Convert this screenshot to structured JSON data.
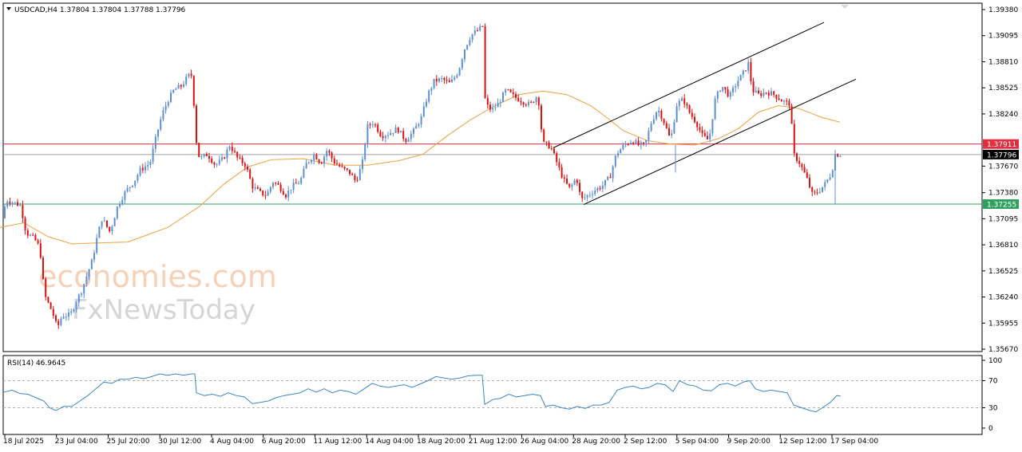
{
  "header": {
    "symbol_label": "USDCAD,H4  1.37804 1.37804 1.37788 1.37796"
  },
  "rsi_header": {
    "label": "RSI(14) 46.9645"
  },
  "watermark": {
    "line1": "economies.com",
    "line2": "FxNewsToday"
  },
  "colors": {
    "bull": "#5b8fd6",
    "bear": "#e01010",
    "ma": "#f0a040",
    "resistance": "#e03040",
    "support": "#30a060",
    "price_line": "#a0a0a0",
    "rsi": "#3a86c8",
    "channel": "#000000"
  },
  "chart_data": [
    {
      "type": "candlestick",
      "timeframe": "H4",
      "ylim": [
        1.3567,
        1.3938
      ],
      "y_ticks": [
        1.3938,
        1.39095,
        1.3881,
        1.38525,
        1.3824,
        1.3767,
        1.3738,
        1.37095,
        1.3681,
        1.36525,
        1.3624,
        1.35955,
        1.3567
      ],
      "x_tick_labels": [
        "18 Jul 2025",
        "23 Jul 04:00",
        "25 Jul 20:00",
        "30 Jul 12:00",
        "4 Aug 04:00",
        "6 Aug 20:00",
        "11 Aug 12:00",
        "14 Aug 04:00",
        "18 Aug 20:00",
        "21 Aug 12:00",
        "26 Aug 04:00",
        "28 Aug 20:00",
        "2 Sep 12:00",
        "5 Sep 04:00",
        "9 Sep 20:00",
        "12 Sep 12:00",
        "17 Sep 04:00"
      ],
      "current_price": {
        "value": 1.37796,
        "label": "1.37796"
      },
      "resistance_level": {
        "value": 1.37911,
        "label": "1.37911"
      },
      "support_level": {
        "value": 1.37255,
        "label": "1.37255"
      },
      "moving_average_path": [
        [
          0,
          1.37
        ],
        [
          30,
          1.3705
        ],
        [
          60,
          1.369
        ],
        [
          90,
          1.3682
        ],
        [
          120,
          1.3683
        ],
        [
          160,
          1.3684
        ],
        [
          210,
          1.37
        ],
        [
          250,
          1.3723
        ],
        [
          280,
          1.3747
        ],
        [
          310,
          1.3766
        ],
        [
          340,
          1.3774
        ],
        [
          380,
          1.3775
        ],
        [
          420,
          1.3768
        ],
        [
          460,
          1.3768
        ],
        [
          500,
          1.3773
        ],
        [
          530,
          1.378
        ],
        [
          560,
          1.38
        ],
        [
          590,
          1.3818
        ],
        [
          620,
          1.3833
        ],
        [
          650,
          1.3845
        ],
        [
          680,
          1.3849
        ],
        [
          710,
          1.3845
        ],
        [
          740,
          1.3833
        ],
        [
          760,
          1.382
        ],
        [
          780,
          1.3806
        ],
        [
          810,
          1.3795
        ],
        [
          840,
          1.3791
        ],
        [
          870,
          1.379
        ],
        [
          900,
          1.3797
        ],
        [
          925,
          1.3808
        ],
        [
          950,
          1.3826
        ],
        [
          975,
          1.3833
        ],
        [
          1000,
          1.383
        ],
        [
          1030,
          1.382
        ],
        [
          1052,
          1.3815
        ]
      ],
      "channel_lines": [
        {
          "from": [
            693,
            1.3787
          ],
          "to": [
            1032,
            1.3924
          ]
        },
        {
          "from": [
            731,
            1.3725
          ],
          "to": [
            1072,
            1.3862
          ]
        }
      ],
      "price_path": [
        [
          5,
          1.371
        ],
        [
          10,
          1.373
        ],
        [
          20,
          1.3727
        ],
        [
          28,
          1.3724
        ],
        [
          35,
          1.3694
        ],
        [
          45,
          1.3688
        ],
        [
          52,
          1.3678
        ],
        [
          58,
          1.3626
        ],
        [
          68,
          1.3607
        ],
        [
          74,
          1.359
        ],
        [
          80,
          1.3604
        ],
        [
          90,
          1.3604
        ],
        [
          98,
          1.362
        ],
        [
          104,
          1.363
        ],
        [
          110,
          1.3645
        ],
        [
          118,
          1.3665
        ],
        [
          124,
          1.369
        ],
        [
          130,
          1.371
        ],
        [
          140,
          1.3695
        ],
        [
          150,
          1.3725
        ],
        [
          160,
          1.374
        ],
        [
          170,
          1.375
        ],
        [
          178,
          1.3763
        ],
        [
          190,
          1.377
        ],
        [
          198,
          1.38
        ],
        [
          205,
          1.3823
        ],
        [
          212,
          1.3838
        ],
        [
          220,
          1.385
        ],
        [
          230,
          1.3855
        ],
        [
          238,
          1.3866
        ],
        [
          244,
          1.3866
        ],
        [
          246,
          1.3805
        ],
        [
          252,
          1.3775
        ],
        [
          262,
          1.378
        ],
        [
          272,
          1.3768
        ],
        [
          282,
          1.3775
        ],
        [
          290,
          1.379
        ],
        [
          300,
          1.3775
        ],
        [
          310,
          1.3768
        ],
        [
          318,
          1.3745
        ],
        [
          328,
          1.3738
        ],
        [
          336,
          1.3735
        ],
        [
          344,
          1.375
        ],
        [
          352,
          1.3745
        ],
        [
          360,
          1.3735
        ],
        [
          368,
          1.3745
        ],
        [
          378,
          1.375
        ],
        [
          386,
          1.377
        ],
        [
          396,
          1.378
        ],
        [
          404,
          1.377
        ],
        [
          412,
          1.3785
        ],
        [
          420,
          1.3772
        ],
        [
          430,
          1.3765
        ],
        [
          440,
          1.376
        ],
        [
          448,
          1.375
        ],
        [
          456,
          1.377
        ],
        [
          462,
          1.381
        ],
        [
          470,
          1.3815
        ],
        [
          480,
          1.38
        ],
        [
          490,
          1.3803
        ],
        [
          500,
          1.3808
        ],
        [
          510,
          1.3795
        ],
        [
          520,
          1.3805
        ],
        [
          530,
          1.382
        ],
        [
          538,
          1.3845
        ],
        [
          546,
          1.386
        ],
        [
          556,
          1.3862
        ],
        [
          566,
          1.3857
        ],
        [
          576,
          1.387
        ],
        [
          584,
          1.3895
        ],
        [
          592,
          1.391
        ],
        [
          600,
          1.3915
        ],
        [
          607,
          1.392
        ],
        [
          610,
          1.3835
        ],
        [
          618,
          1.3828
        ],
        [
          626,
          1.3835
        ],
        [
          636,
          1.385
        ],
        [
          646,
          1.3843
        ],
        [
          656,
          1.3838
        ],
        [
          666,
          1.3834
        ],
        [
          676,
          1.3845
        ],
        [
          682,
          1.3792
        ],
        [
          692,
          1.3788
        ],
        [
          700,
          1.377
        ],
        [
          708,
          1.3752
        ],
        [
          716,
          1.3742
        ],
        [
          724,
          1.3755
        ],
        [
          730,
          1.373
        ],
        [
          738,
          1.3735
        ],
        [
          746,
          1.374
        ],
        [
          756,
          1.3745
        ],
        [
          766,
          1.3755
        ],
        [
          774,
          1.378
        ],
        [
          784,
          1.379
        ],
        [
          794,
          1.3795
        ],
        [
          802,
          1.379
        ],
        [
          810,
          1.379
        ],
        [
          818,
          1.3815
        ],
        [
          826,
          1.383
        ],
        [
          834,
          1.3815
        ],
        [
          842,
          1.3795
        ],
        [
          850,
          1.3835
        ],
        [
          858,
          1.384
        ],
        [
          866,
          1.3825
        ],
        [
          874,
          1.3815
        ],
        [
          882,
          1.38
        ],
        [
          890,
          1.3795
        ],
        [
          898,
          1.384
        ],
        [
          906,
          1.3855
        ],
        [
          916,
          1.3843
        ],
        [
          926,
          1.386
        ],
        [
          934,
          1.387
        ],
        [
          940,
          1.388
        ],
        [
          944,
          1.385
        ],
        [
          952,
          1.3845
        ],
        [
          962,
          1.3848
        ],
        [
          972,
          1.3845
        ],
        [
          982,
          1.3838
        ],
        [
          992,
          1.3835
        ],
        [
          996,
          1.378
        ],
        [
          1004,
          1.377
        ],
        [
          1012,
          1.3755
        ],
        [
          1020,
          1.3735
        ],
        [
          1028,
          1.374
        ],
        [
          1036,
          1.3748
        ],
        [
          1044,
          1.376
        ],
        [
          1048,
          1.378
        ],
        [
          1053,
          1.37796
        ]
      ]
    },
    {
      "type": "line",
      "title": "RSI(14) 46.9645",
      "ylim": [
        0,
        100
      ],
      "y_ticks": [
        100,
        70,
        30,
        0
      ],
      "levels": [
        70,
        30
      ],
      "series": [
        {
          "values": [
            [
              5,
              53
            ],
            [
              15,
              56
            ],
            [
              25,
              51
            ],
            [
              35,
              50
            ],
            [
              45,
              45
            ],
            [
              55,
              40
            ],
            [
              62,
              30
            ],
            [
              70,
              26
            ],
            [
              80,
              32
            ],
            [
              90,
              32
            ],
            [
              100,
              40
            ],
            [
              110,
              48
            ],
            [
              120,
              58
            ],
            [
              130,
              68
            ],
            [
              140,
              66
            ],
            [
              150,
              72
            ],
            [
              160,
              72
            ],
            [
              170,
              75
            ],
            [
              180,
              73
            ],
            [
              190,
              76
            ],
            [
              200,
              80
            ],
            [
              210,
              78
            ],
            [
              220,
              80
            ],
            [
              230,
              78
            ],
            [
              240,
              80
            ],
            [
              244,
              80
            ],
            [
              246,
              52
            ],
            [
              256,
              48
            ],
            [
              266,
              50
            ],
            [
              276,
              47
            ],
            [
              286,
              52
            ],
            [
              296,
              48
            ],
            [
              306,
              46
            ],
            [
              316,
              36
            ],
            [
              326,
              38
            ],
            [
              336,
              40
            ],
            [
              346,
              45
            ],
            [
              356,
              48
            ],
            [
              366,
              50
            ],
            [
              376,
              52
            ],
            [
              386,
              58
            ],
            [
              396,
              53
            ],
            [
              406,
              58
            ],
            [
              416,
              52
            ],
            [
              426,
              56
            ],
            [
              436,
              54
            ],
            [
              446,
              50
            ],
            [
              456,
              58
            ],
            [
              466,
              66
            ],
            [
              476,
              62
            ],
            [
              486,
              60
            ],
            [
              496,
              62
            ],
            [
              506,
              64
            ],
            [
              516,
              60
            ],
            [
              526,
              65
            ],
            [
              536,
              70
            ],
            [
              546,
              76
            ],
            [
              556,
              74
            ],
            [
              566,
              72
            ],
            [
              576,
              74
            ],
            [
              586,
              77
            ],
            [
              596,
              78
            ],
            [
              604,
              78
            ],
            [
              607,
              35
            ],
            [
              617,
              42
            ],
            [
              627,
              44
            ],
            [
              637,
              50
            ],
            [
              647,
              46
            ],
            [
              657,
              48
            ],
            [
              667,
              50
            ],
            [
              677,
              48
            ],
            [
              683,
              32
            ],
            [
              693,
              34
            ],
            [
              703,
              30
            ],
            [
              713,
              28
            ],
            [
              723,
              32
            ],
            [
              733,
              29
            ],
            [
              743,
              34
            ],
            [
              753,
              34
            ],
            [
              763,
              38
            ],
            [
              773,
              56
            ],
            [
              783,
              60
            ],
            [
              793,
              62
            ],
            [
              803,
              58
            ],
            [
              813,
              60
            ],
            [
              823,
              66
            ],
            [
              833,
              64
            ],
            [
              843,
              54
            ],
            [
              851,
              70
            ],
            [
              861,
              64
            ],
            [
              871,
              62
            ],
            [
              881,
              56
            ],
            [
              891,
              55
            ],
            [
              901,
              64
            ],
            [
              911,
              66
            ],
            [
              921,
              62
            ],
            [
              931,
              68
            ],
            [
              939,
              70
            ],
            [
              946,
              58
            ],
            [
              956,
              54
            ],
            [
              966,
              56
            ],
            [
              976,
              54
            ],
            [
              986,
              52
            ],
            [
              994,
              34
            ],
            [
              1004,
              30
            ],
            [
              1014,
              26
            ],
            [
              1022,
              24
            ],
            [
              1030,
              30
            ],
            [
              1040,
              38
            ],
            [
              1048,
              48
            ],
            [
              1053,
              47
            ]
          ]
        }
      ]
    }
  ]
}
